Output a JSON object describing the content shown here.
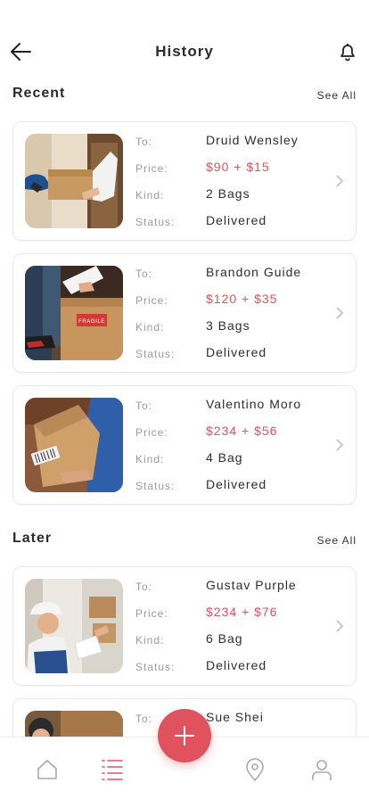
{
  "header": {
    "title": "History"
  },
  "sections": {
    "recent": {
      "title": "Recent",
      "see_all": "See All"
    },
    "later": {
      "title": "Later",
      "see_all": "See All"
    }
  },
  "labels": {
    "to": "To:",
    "price": "Price:",
    "kind": "Kind:",
    "status": "Status:"
  },
  "orders": [
    {
      "to": "Druid Wensley",
      "price": "$90 + $15",
      "kind": "2 Bags",
      "status": "Delivered"
    },
    {
      "to": "Brandon Guide",
      "price": "$120 + $35",
      "kind": "3 Bags",
      "status": "Delivered"
    },
    {
      "to": "Valentino Moro",
      "price": "$234 + $56",
      "kind": "4 Bag",
      "status": "Delivered"
    },
    {
      "to": "Gustav Purple",
      "price": "$234 + $76",
      "kind": "6 Bag",
      "status": "Delivered"
    },
    {
      "to": "Sue Shei"
    }
  ],
  "image_text": {
    "fragile": "FRAGILE"
  },
  "colors": {
    "accent": "#e0525d",
    "nav_active": "#e0525d",
    "nav_inactive": "#a9a9a9"
  },
  "nav": [
    "home-icon",
    "list-icon",
    "add-icon",
    "location-icon",
    "profile-icon"
  ]
}
